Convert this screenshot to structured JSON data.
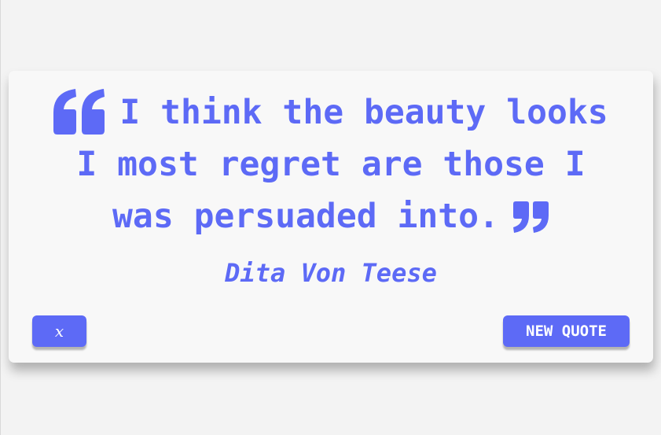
{
  "quote": {
    "text": "I think the beauty looks I most regret are those I was persuaded into.",
    "author": "Dita Von Teese",
    "open_icon": "quote-left-icon",
    "close_icon": "quote-right-icon"
  },
  "actions": {
    "share_label": "𝑥",
    "share_icon": "x-twitter-icon",
    "new_quote_label": "NEW QUOTE"
  },
  "colors": {
    "accent": "#5d6af6",
    "card": "#f8f8f8",
    "background": "#f3f3f3"
  }
}
